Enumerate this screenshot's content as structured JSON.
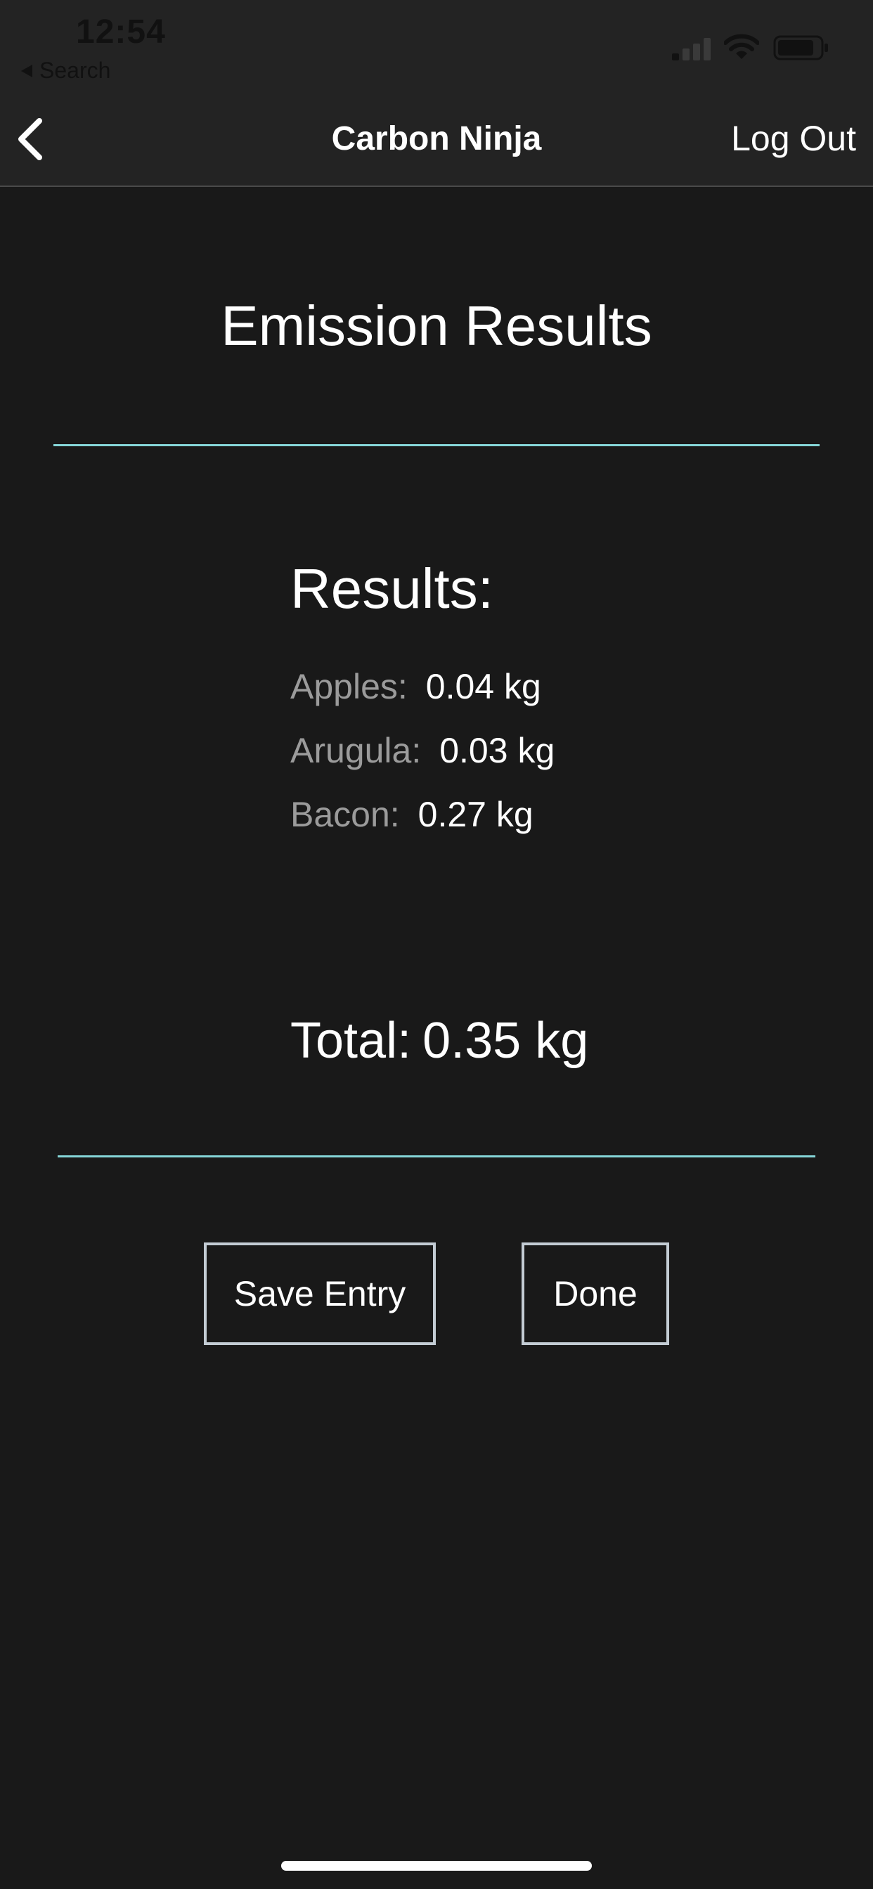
{
  "status_bar": {
    "time": "12:54",
    "back_app": "Search",
    "icons": [
      "signal-icon",
      "wifi-icon",
      "battery-icon"
    ]
  },
  "nav": {
    "title": "Carbon Ninja",
    "logout_label": "Log Out",
    "back_icon": "chevron-left-icon"
  },
  "page": {
    "heading": "Emission Results",
    "results_heading": "Results:",
    "items": [
      {
        "label": "Apples:",
        "value": "0.04 kg"
      },
      {
        "label": "Arugula:",
        "value": "0.03 kg"
      },
      {
        "label": "Bacon:",
        "value": "0.27 kg"
      }
    ],
    "total_label": "Total:",
    "total_value": "0.35 kg"
  },
  "actions": {
    "save_label": "Save Entry",
    "done_label": "Done"
  },
  "colors": {
    "background": "#191919",
    "bar_background": "#232323",
    "accent_divider": "#86d7d9",
    "button_border": "#c3ccd4",
    "muted_label": "#9b9b9b"
  }
}
